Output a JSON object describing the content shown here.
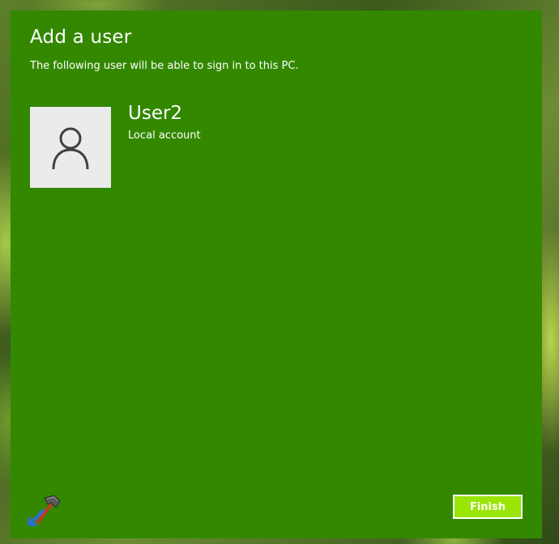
{
  "dialog": {
    "title": "Add a user",
    "subtitle": "The following user will be able to sign in to this PC.",
    "background_color": "#338800"
  },
  "user": {
    "name": "User2",
    "account_type": "Local account",
    "avatar_icon": "person-icon"
  },
  "actions": {
    "finish_label": "Finish",
    "finish_color": "#99e606"
  },
  "branding": {
    "logo_icon": "hammer-arrow-logo-icon"
  }
}
